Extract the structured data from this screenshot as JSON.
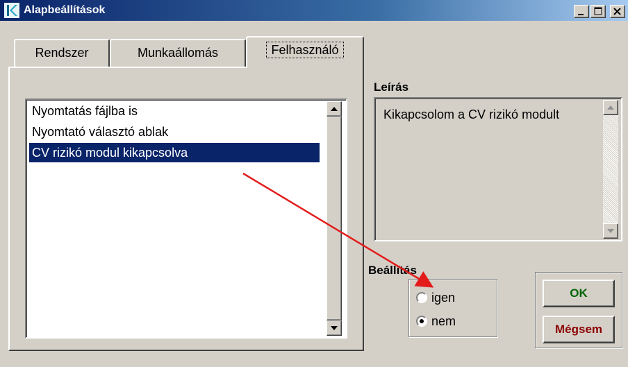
{
  "window": {
    "title": "Alapbeállítások",
    "controls": [
      "minimize",
      "maximize",
      "close"
    ]
  },
  "tabs": [
    {
      "label": "Rendszer",
      "active": false
    },
    {
      "label": "Munkaállomás",
      "active": false
    },
    {
      "label": "Felhasználó",
      "active": true
    }
  ],
  "options_list": {
    "items": [
      {
        "label": "Nyomtatás fájlba is",
        "selected": false
      },
      {
        "label": "Nyomtató választó ablak",
        "selected": false
      },
      {
        "label": "CV rizikó modul kikapcsolva",
        "selected": true
      }
    ]
  },
  "description": {
    "label": "Leírás",
    "text": "Kikapcsolom a CV rizikó modult"
  },
  "setting": {
    "label": "Beállítás",
    "options": [
      {
        "label": "igen",
        "checked": false
      },
      {
        "label": "nem",
        "checked": true
      }
    ]
  },
  "buttons": {
    "ok": "OK",
    "cancel": "Mégsem"
  },
  "colors": {
    "titlebar": "#0a246a",
    "selection": "#0a246a",
    "ok_text": "#006400",
    "cancel_text": "#8b0000",
    "annotation_arrow": "#e31b1b"
  }
}
